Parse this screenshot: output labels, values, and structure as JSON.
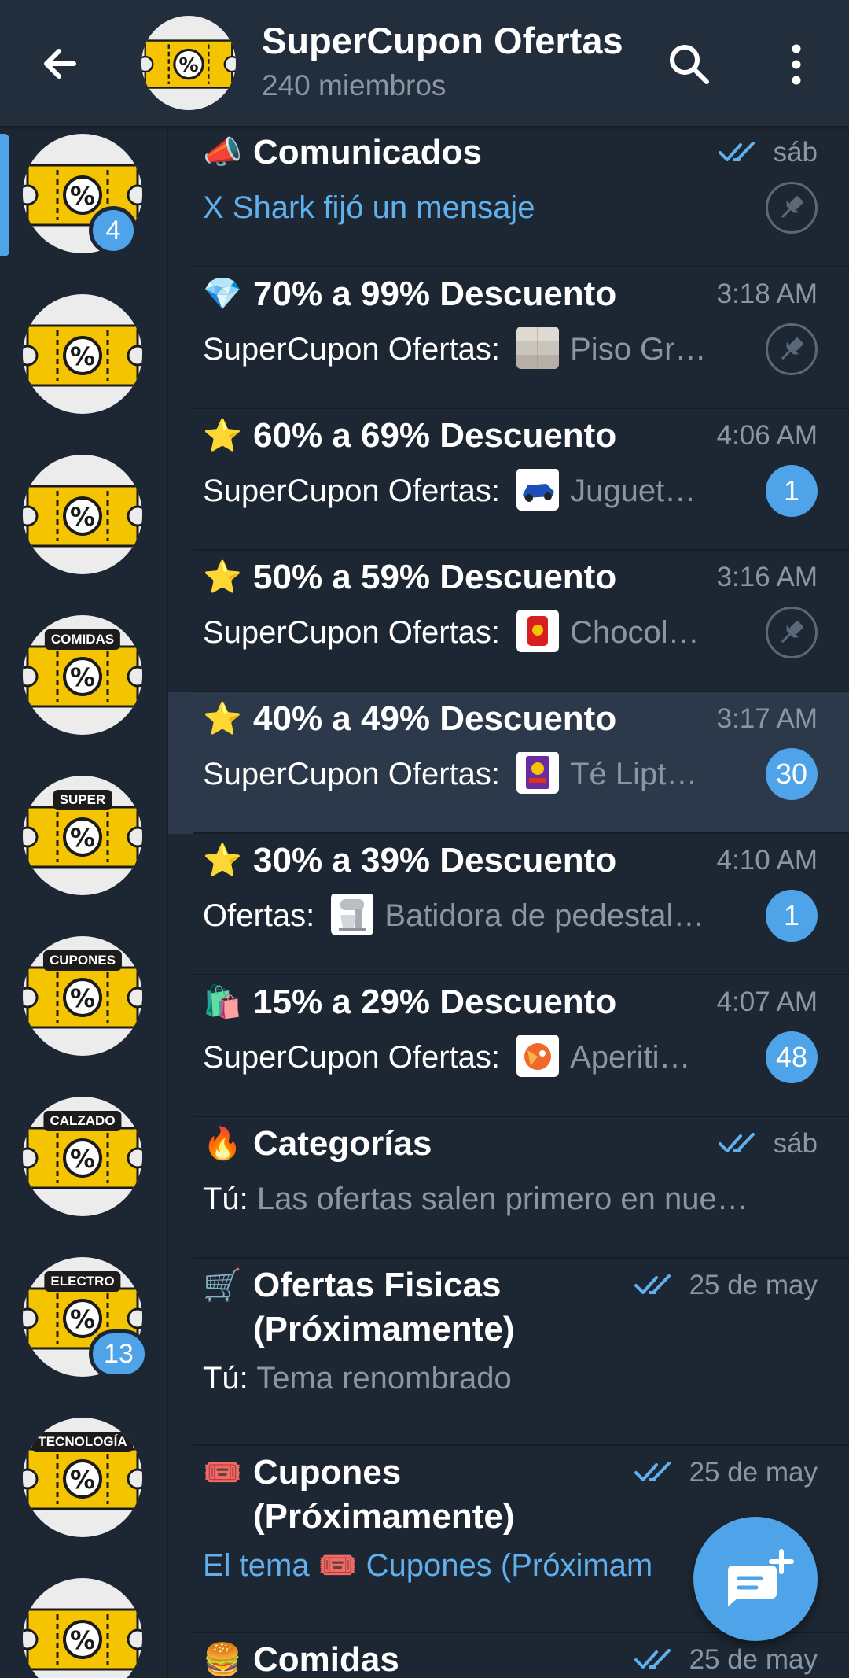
{
  "header": {
    "title": "SuperCupon Ofertas",
    "subtitle": "240 miembros"
  },
  "rail": {
    "items": [
      {
        "tag": "",
        "badge": "4"
      },
      {
        "tag": "",
        "badge": ""
      },
      {
        "tag": "",
        "badge": ""
      },
      {
        "tag": "COMIDAS",
        "badge": ""
      },
      {
        "tag": "SUPER",
        "badge": ""
      },
      {
        "tag": "CUPONES",
        "badge": ""
      },
      {
        "tag": "CALZADO",
        "badge": ""
      },
      {
        "tag": "ELECTRO",
        "badge": "13"
      },
      {
        "tag": "TECNOLOGÍA",
        "badge": ""
      },
      {
        "tag": "",
        "badge": ""
      }
    ]
  },
  "topics": [
    {
      "emoji": "📣",
      "title": "Comunicados",
      "time": "sáb",
      "read_ticks": true,
      "sender": "",
      "message": "X Shark fijó un mensaje",
      "style": "blue",
      "pinned": true,
      "count": ""
    },
    {
      "emoji": "💎",
      "title": "70% a 99% Descuento",
      "time": "3:18 AM",
      "read_ticks": false,
      "sender": "SuperCupon Ofertas:",
      "message": "Piso Gr…",
      "thumb": "floor",
      "pinned": true,
      "count": ""
    },
    {
      "emoji": "⭐",
      "title": "60% a 69% Descuento",
      "time": "4:06 AM",
      "read_ticks": false,
      "sender": "SuperCupon Ofertas:",
      "message": "Juguet…",
      "thumb": "toy",
      "pinned": false,
      "count": "1"
    },
    {
      "emoji": "⭐",
      "title": "50% a 59% Descuento",
      "time": "3:16 AM",
      "read_ticks": false,
      "sender": "SuperCupon Ofertas:",
      "message": "Chocol…",
      "thumb": "choco",
      "pinned": true,
      "count": ""
    },
    {
      "emoji": "⭐",
      "title": "40% a 49% Descuento",
      "time": "3:17 AM",
      "read_ticks": false,
      "sender": "SuperCupon Ofertas:",
      "message": "Té Lipt…",
      "thumb": "tea",
      "pinned": false,
      "count": "30"
    },
    {
      "emoji": "⭐",
      "title": "30% a 39% Descuento",
      "time": "4:10 AM",
      "read_ticks": false,
      "sender": "Ofertas:",
      "message": "Batidora de pedestal…",
      "thumb": "mixer",
      "pinned": false,
      "count": "1"
    },
    {
      "emoji": "🛍️",
      "title": "15% a 29% Descuento",
      "time": "4:07 AM",
      "read_ticks": false,
      "sender": "SuperCupon Ofertas:",
      "message": "Aperiti…",
      "thumb": "snack",
      "pinned": false,
      "count": "48"
    },
    {
      "emoji": "🔥",
      "title": "Categorías",
      "time": "sáb",
      "read_ticks": true,
      "sender": "Tú:",
      "message": "Las ofertas salen primero en nue…",
      "pinned": false,
      "count": ""
    },
    {
      "emoji": "🛒",
      "title": "Ofertas Fisicas (Próximamente)",
      "time": "25 de may",
      "read_ticks": true,
      "sender": "Tú:",
      "message": "Tema renombrado",
      "pinned": false,
      "count": ""
    },
    {
      "emoji": "🎟️",
      "title": "Cupones (Próximamente)",
      "time": "25 de may",
      "read_ticks": true,
      "sender": "El tema",
      "message": "🎟️ Cupones (Próximam",
      "style": "blue",
      "pinned": false,
      "count": ""
    },
    {
      "emoji": "🍔",
      "title": "Comidas",
      "time": "25 de may",
      "read_ticks": true,
      "sender": "",
      "message": "",
      "pinned": false,
      "count": ""
    }
  ],
  "colors": {
    "background": "#1d2733",
    "header": "#232e3c",
    "accent": "#4fa3e8",
    "muted_text": "#8a96a3",
    "link_text": "#5fb0ec"
  },
  "icons": {
    "back": "arrow-left-icon",
    "search": "search-icon",
    "more": "more-vertical-icon",
    "pin": "pin-icon",
    "read": "double-check-icon",
    "fab": "new-topic-icon"
  }
}
